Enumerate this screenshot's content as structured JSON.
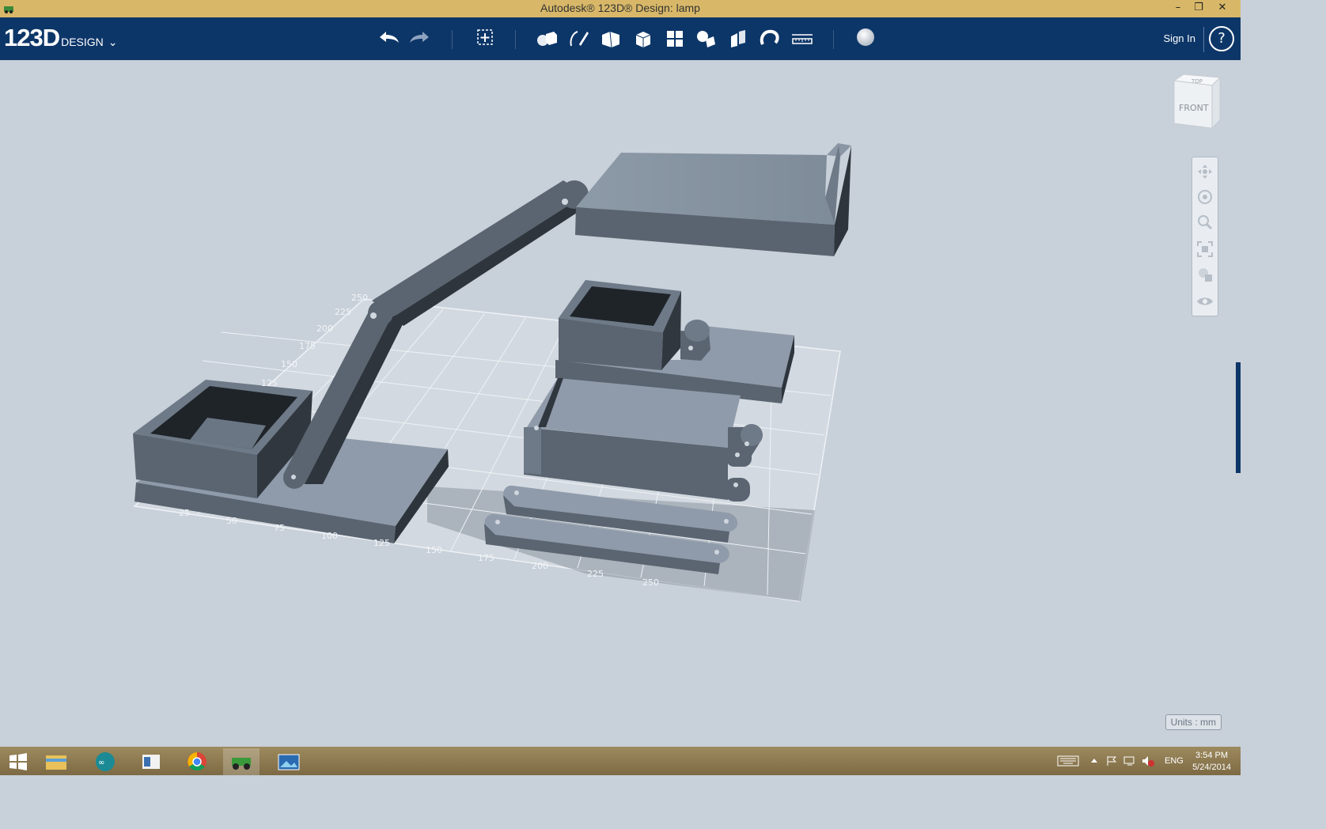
{
  "window": {
    "title": "Autodesk® 123D® Design: lamp",
    "min": "–",
    "max": "❐",
    "close": "✕"
  },
  "app": {
    "logo_main": "123D",
    "logo_sub": "DESIGN",
    "logo_chevron": "⌄"
  },
  "toolbar": {
    "buttons": [
      {
        "name": "undo-button",
        "icon": "undo-icon"
      },
      {
        "name": "redo-button",
        "icon": "redo-icon"
      },
      {
        "name": "transform-button",
        "icon": "transform-icon"
      },
      {
        "name": "primitives-button",
        "icon": "primitives-icon"
      },
      {
        "name": "sketch-button",
        "icon": "sketch-icon"
      },
      {
        "name": "construct-button",
        "icon": "construct-icon"
      },
      {
        "name": "modify-button",
        "icon": "modify-icon"
      },
      {
        "name": "pattern-button",
        "icon": "pattern-icon"
      },
      {
        "name": "group-button",
        "icon": "group-icon"
      },
      {
        "name": "combine-button",
        "icon": "combine-icon"
      },
      {
        "name": "snap-button",
        "icon": "snap-icon"
      },
      {
        "name": "measure-button",
        "icon": "measure-icon"
      },
      {
        "name": "material-button",
        "icon": "material-icon"
      }
    ],
    "sign_in": "Sign In",
    "help": "?"
  },
  "viewcube": {
    "top": "TOP",
    "front": "FRONT"
  },
  "grid": {
    "x_ticks": [
      "25",
      "50",
      "75",
      "100",
      "125",
      "150",
      "175",
      "200",
      "225",
      "250"
    ],
    "y_ticks": [
      "125",
      "150",
      "175",
      "200",
      "225",
      "250"
    ]
  },
  "units_label": "Units : mm",
  "taskbar": {
    "items": [
      "start-icon",
      "file-explorer-icon",
      "arduino-icon",
      "notes-icon",
      "chrome-icon",
      "123d-icon",
      "photos-icon"
    ],
    "lang": "ENG",
    "time": "3:54 PM",
    "date": "5/24/2014"
  },
  "colors": {
    "toolbar_bg": "#0d3668",
    "titlebar_bg": "#d8b868",
    "viewport_bg": "#c8d0d9",
    "model_gray": "#5b6571"
  }
}
